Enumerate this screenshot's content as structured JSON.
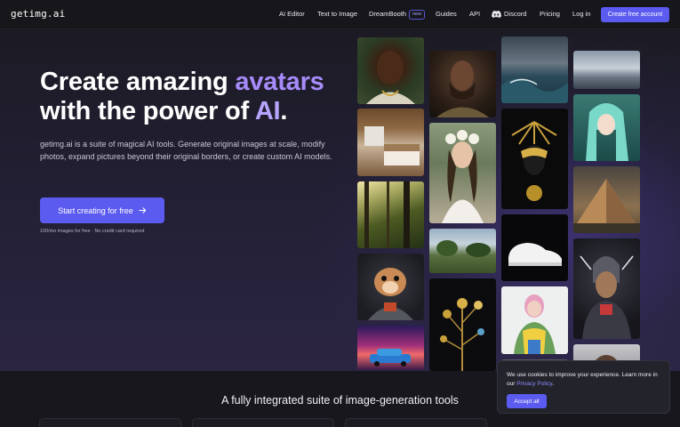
{
  "nav": {
    "logo": "getimg.ai",
    "links": [
      "AI Editor",
      "Text to Image",
      "DreamBooth",
      "Guides",
      "API",
      "Discord",
      "Pricing",
      "Log in"
    ],
    "new_badge": "new",
    "cta": "Create free account"
  },
  "hero": {
    "title_part1": "Create amazing ",
    "title_accent": "avatars",
    "title_part2": "with the power of ",
    "title_accent2": "AI",
    "title_end": ".",
    "description": "getimg.ai is a suite of magical AI tools. Generate original images at scale, modify photos, expand pictures beyond their original borders, or create custom AI models.",
    "button": "Start creating for free",
    "note": "100/mo images for free · No credit card required"
  },
  "gallery": {
    "tiles": [
      "man-portrait",
      "bedroom",
      "forest",
      "hamster-astronaut",
      "synthwave-car",
      "warrior-portrait",
      "flower-crown-woman",
      "meadow",
      "golden-flowers",
      "ocean-storm",
      "golden-mask",
      "white-sneaker",
      "girl-puffer-jacket",
      "clouds",
      "anime-girl",
      "pyramid",
      "cyborg-man",
      "woman-portrait"
    ]
  },
  "section": {
    "title": "A fully integrated suite of image-generation tools"
  },
  "cookie": {
    "text": "We use cookies to improve your experience. Learn more in our ",
    "link": "Privacy Policy",
    "end": ".",
    "button": "Accept all"
  },
  "colors": {
    "accent": "#5b5bf0",
    "heading_accent": "#a78bfa",
    "background": "#17171d"
  }
}
